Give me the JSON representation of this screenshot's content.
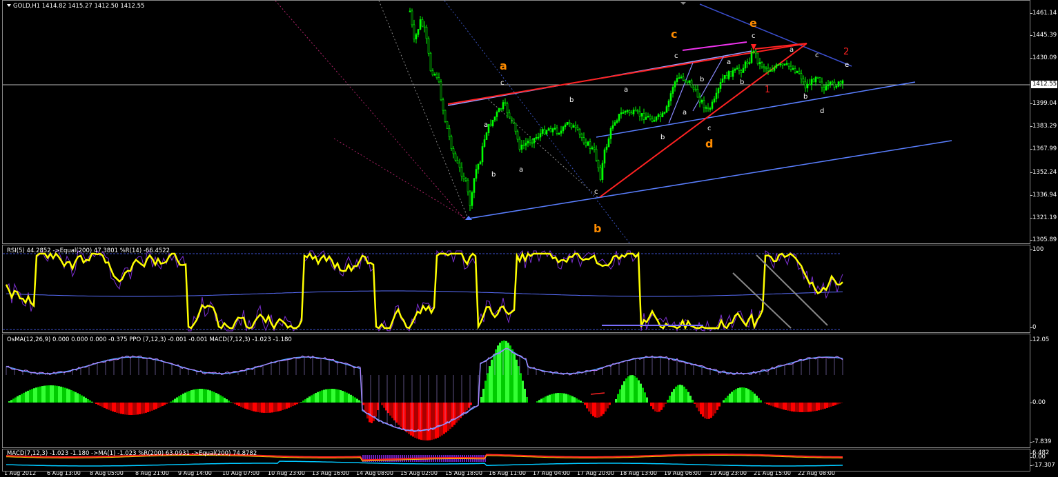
{
  "main": {
    "header": "GOLD,H1  1414.82 1415.27 1412.50 1412.55",
    "current_price": "1412.55",
    "price_ticks": [
      "1461.14",
      "1445.39",
      "1430.09",
      "1399.04",
      "1383.29",
      "1367.99",
      "1352.24",
      "1336.94",
      "1321.19",
      "1305.89"
    ],
    "wave_labels": {
      "a_orange": "a",
      "b_orange": "b",
      "c_orange": "c",
      "d_orange": "d",
      "e_orange": "e",
      "one_red": "1",
      "two_red": "2",
      "a1": "a",
      "a2": "a",
      "a3": "a",
      "a4": "a",
      "a5": "a",
      "a6": "a",
      "b1": "b",
      "b2": "b",
      "b3": "b",
      "b4": "b",
      "b5": "b",
      "b6": "b",
      "b7": "b",
      "c1": "c",
      "c2": "c",
      "c3": "c",
      "c4": "c",
      "c5": "c",
      "c6": "c",
      "d1": "d",
      "e1": "e"
    }
  },
  "rsi": {
    "header": "RSI(5) 44.2852   ->Equal(200) 47.3801  %R(14) -66.4522",
    "ticks": [
      "100",
      "0"
    ]
  },
  "osma": {
    "header": "OsMA(12,26,9) 0.000 0.000 0.000 -0.375   PPO (7,12,3) -0.001 -0.001   MACD(7,12,3) -1.023 -1.180",
    "ticks": [
      "12.05",
      "0.00",
      "-7.839"
    ]
  },
  "macd": {
    "header": "MACD(7,12,3) -1.023 -1.180  ->MA(1) -1.023  %R(200) 63.0931  ->Equal(200) 74.8782",
    "ticks": [
      "6.482",
      "0.00",
      "-17.307"
    ]
  },
  "xaxis": [
    "1 Aug 2012",
    "6 Aug 13:00",
    "8 Aug 05:00",
    "8 Aug 21:00",
    "9 Aug 14:00",
    "10 Aug 07:00",
    "10 Aug 23:00",
    "13 Aug 16:00",
    "14 Aug 08:00",
    "15 Aug 02:00",
    "15 Aug 18:00",
    "16 Aug 11:00",
    "17 Aug 04:00",
    "17 Aug 20:00",
    "18 Aug 13:00",
    "19 Aug 06:00",
    "19 Aug 23:00",
    "21 Aug 15:00",
    "22 Aug 08:00"
  ],
  "colors": {
    "candle": "#00ff00",
    "rsi": "#ffff00",
    "trend_red": "#ff2222",
    "channel_blue": "#5a7fff",
    "hist_green": "#00cc00",
    "hist_red": "#ff0000",
    "wave_orange": "#ff8c00"
  }
}
